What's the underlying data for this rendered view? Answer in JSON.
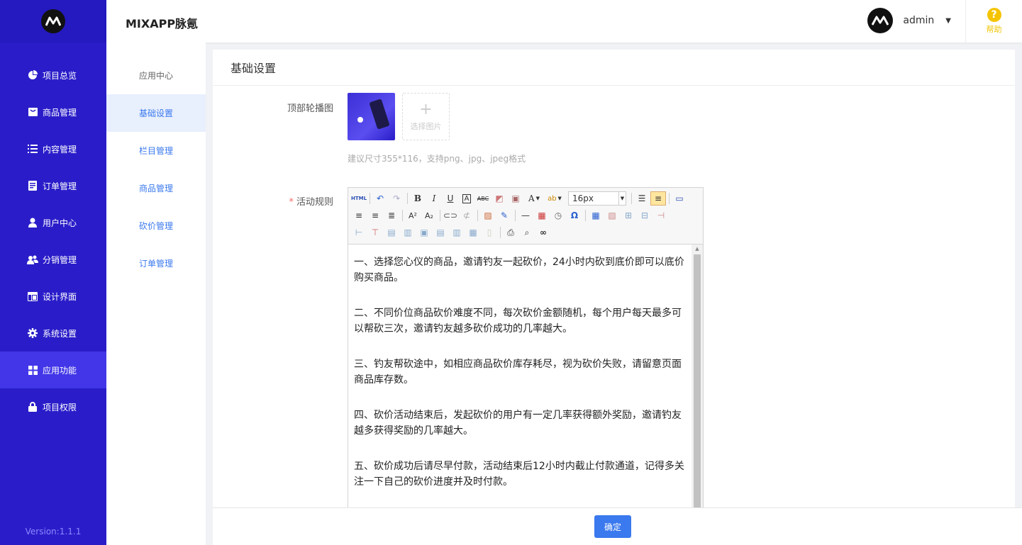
{
  "app": {
    "title": "MIXAPP脉氪",
    "version": "Version:1.1.1"
  },
  "sidebar": {
    "items": [
      {
        "label": "项目总览",
        "icon": "pie-chart-icon"
      },
      {
        "label": "商品管理",
        "icon": "bag-icon"
      },
      {
        "label": "内容管理",
        "icon": "list-icon"
      },
      {
        "label": "订单管理",
        "icon": "order-icon"
      },
      {
        "label": "用户中心",
        "icon": "user-icon"
      },
      {
        "label": "分销管理",
        "icon": "users-icon"
      },
      {
        "label": "设计界面",
        "icon": "layout-icon"
      },
      {
        "label": "系统设置",
        "icon": "gear-icon"
      },
      {
        "label": "应用功能",
        "icon": "grid-icon",
        "active": true
      },
      {
        "label": "项目权限",
        "icon": "lock-icon"
      }
    ]
  },
  "header": {
    "username": "admin",
    "help_label": "帮助"
  },
  "subnav": {
    "items": [
      {
        "label": "应用中心"
      },
      {
        "label": "基础设置",
        "active": true
      },
      {
        "label": "栏目管理"
      },
      {
        "label": "商品管理"
      },
      {
        "label": "砍价管理"
      },
      {
        "label": "订单管理"
      }
    ]
  },
  "page": {
    "title": "基础设置",
    "carousel_label": "顶部轮播图",
    "picker_label": "选择图片",
    "picker_plus": "+",
    "hint": "建议尺寸355*116，支持png、jpg、jpeg格式",
    "rules_label": "活动规则",
    "required_mark": "*"
  },
  "editor": {
    "font_size": "16px",
    "paragraphs": [
      "一、选择您心仪的商品，邀请钓友一起砍价，24小时内砍到底价即可以底价购买商品。",
      "二、不同价位商品砍价难度不同，每次砍价金额随机，每个用户每天最多可以帮砍三次，邀请钓友越多砍价成功的几率越大。",
      "三、钓友帮砍途中，如相应商品砍价库存耗尽，视为砍价失败，请留意页面商品库存数。",
      "四、砍价活动结束后，发起砍价的用户有一定几率获得额外奖励，邀请钓友越多获得奖励的几率越大。",
      "五、砍价成功后请尽早付款，活动结束后12小时内截止付款通道，记得多关注一下自己的砍价进度并及时付款。"
    ]
  },
  "footer": {
    "confirm_label": "确定"
  },
  "colors": {
    "sidebar": "#2a1dc9",
    "sidebar_active": "#4236e8",
    "primary": "#3a79ee",
    "help": "#f5c400"
  }
}
